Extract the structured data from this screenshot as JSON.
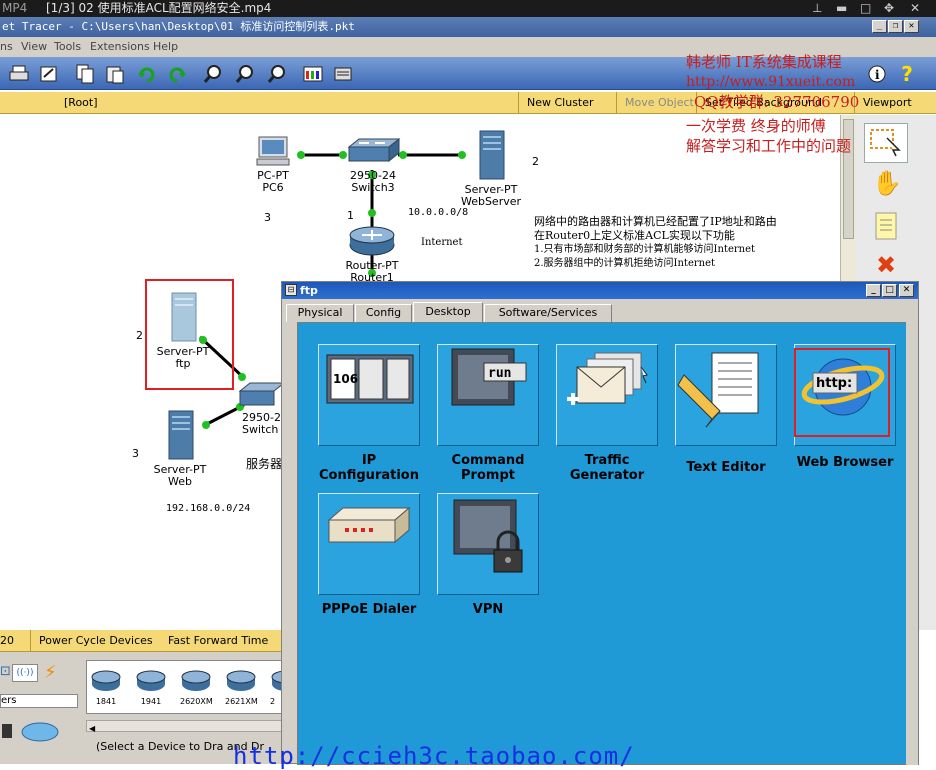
{
  "player": {
    "format": "MP4",
    "title": "[1/3] 02 使用标准ACL配置网络安全.mp4"
  },
  "window": {
    "title": "et Tracer - C:\\Users\\han\\Desktop\\01 标准访问控制列表.pkt"
  },
  "menu": [
    "ns",
    "View",
    "Tools",
    "Extensions",
    "Help"
  ],
  "subbar": {
    "root": "[Root]",
    "new_cluster": "New Cluster",
    "move_object": "Move Object",
    "set_bg": "Set Tiled Background",
    "viewport": "Viewport"
  },
  "overlay": {
    "line1": "韩老师 IT系统集成课程",
    "line2": "http://www.91xueit.com",
    "line3": "QQ教学群: 327706790",
    "line4": "一次学费  终身的师傅",
    "line5": "解答学习和工作中的问题"
  },
  "topology": {
    "pc_type": "PC-PT",
    "pc_name": "PC6",
    "sw3_type": "2950-24",
    "sw3_name": "Switch3",
    "websrv_type": "Server-PT",
    "websrv_name": "WebServer",
    "router_type": "Router-PT",
    "router_name": "Router1",
    "ftp_type": "Server-PT",
    "ftp_name": "ftp",
    "sw_type": "2950-2",
    "sw_name": "Switch",
    "web_type": "Server-PT",
    "web_name": "Web",
    "num_3a": "3",
    "num_1": "1",
    "num_2a": "2",
    "num_2b": "2",
    "num_3b": "3",
    "net_10": "10.0.0.0/8",
    "internet": "Internet",
    "net_192": "192.168.0.0/24",
    "server_group": "服务器",
    "note_line1": "网络中的路由器和计算机已经配置了IP地址和路由",
    "note_line2": "在Router0上定义标准ACL实现以下功能",
    "note_line3": "1.只有市场部和财务部的计算机能够访问Internet",
    "note_line4": "2.服务器组中的计算机拒绝访问Internet"
  },
  "bottom": {
    "count": "20",
    "power_cycle": "Power Cycle Devices",
    "fast_forward": "Fast Forward Time",
    "routers_label": "ers",
    "models": [
      "1841",
      "1941",
      "2620XM",
      "2621XM",
      "2"
    ],
    "hint": "(Select a Device to Dra",
    "hint2": "and Dr"
  },
  "dialog": {
    "title": "ftp",
    "tabs": [
      "Physical",
      "Config",
      "Desktop",
      "Software/Services"
    ],
    "active_tab": "Desktop",
    "apps": [
      {
        "label1": "IP",
        "label2": "Configuration",
        "icon": "ip-config-icon",
        "icon_text": "106"
      },
      {
        "label1": "Command",
        "label2": "Prompt",
        "icon": "command-prompt-icon",
        "icon_text": "run"
      },
      {
        "label1": "Traffic",
        "label2": "Generator",
        "icon": "traffic-generator-icon"
      },
      {
        "label1": "Text Editor",
        "label2": "",
        "icon": "text-editor-icon"
      },
      {
        "label1": "Web Browser",
        "label2": "",
        "icon": "web-browser-icon",
        "icon_text": "http:"
      },
      {
        "label1": "PPPoE Dialer",
        "label2": "",
        "icon": "pppoe-dialer-icon"
      },
      {
        "label1": "VPN",
        "label2": "",
        "icon": "vpn-icon"
      }
    ]
  },
  "watermark": "http://ccieh3c.taobao.com/",
  "colors": {
    "title_blue": "#3e62a0",
    "desktop_blue": "#209ad7",
    "highlight_red": "#e02020",
    "link_green": "#1fc11f"
  }
}
